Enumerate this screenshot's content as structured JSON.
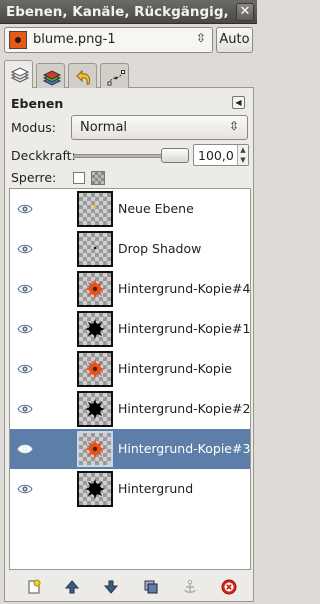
{
  "window": {
    "title": "Ebenen, Kanäle, Rückgängig, Pfade - Pinsel..."
  },
  "image_selector": {
    "name": "blume.png-1",
    "auto_label": "Auto"
  },
  "tabs": [
    {
      "icon": "layers-tab-icon",
      "active": true
    },
    {
      "icon": "channels-tab-icon",
      "active": false
    },
    {
      "icon": "undo-history-tab-icon",
      "active": false
    },
    {
      "icon": "paths-tab-icon",
      "active": false
    }
  ],
  "panel": {
    "title": "Ebenen",
    "mode_label": "Modus:",
    "mode_value": "Normal",
    "opacity_label": "Deckkraft:",
    "opacity_value": "100,0",
    "lock_label": "Sperre:"
  },
  "layers": [
    {
      "name": "Neue Ebene",
      "visible": true,
      "thumb": "dot-yellow",
      "selected": false
    },
    {
      "name": "Drop Shadow",
      "visible": true,
      "thumb": "dot-dark",
      "selected": false
    },
    {
      "name": "Hintergrund-Kopie#4",
      "visible": true,
      "thumb": "flower-orange",
      "selected": false
    },
    {
      "name": "Hintergrund-Kopie#1",
      "visible": true,
      "thumb": "flower-black",
      "selected": false
    },
    {
      "name": "Hintergrund-Kopie",
      "visible": true,
      "thumb": "flower-orange",
      "selected": false
    },
    {
      "name": "Hintergrund-Kopie#2",
      "visible": true,
      "thumb": "flower-black",
      "selected": false
    },
    {
      "name": "Hintergrund-Kopie#3",
      "visible": true,
      "thumb": "flower-orange",
      "selected": true
    },
    {
      "name": "Hintergrund",
      "visible": true,
      "thumb": "flower-black",
      "selected": false
    }
  ],
  "bottom_buttons": [
    {
      "icon": "new-layer-icon"
    },
    {
      "icon": "raise-layer-icon"
    },
    {
      "icon": "lower-layer-icon"
    },
    {
      "icon": "duplicate-layer-icon"
    },
    {
      "icon": "anchor-layer-icon"
    },
    {
      "icon": "delete-layer-icon"
    }
  ],
  "colors": {
    "selection": "#5d7ea8",
    "flower_orange": "#e5531a",
    "titlebar": "#4a4843"
  }
}
